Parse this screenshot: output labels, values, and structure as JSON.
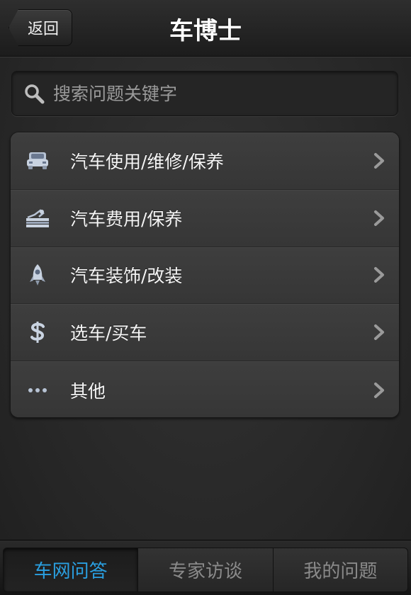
{
  "header": {
    "back_label": "返回",
    "title": "车博士"
  },
  "search": {
    "placeholder": "搜索问题关键字",
    "icon": "search-icon"
  },
  "menu": {
    "items": [
      {
        "label": "汽车使用/维修/保养",
        "icon": "car-icon"
      },
      {
        "label": "汽车费用/保养",
        "icon": "money-stack-icon"
      },
      {
        "label": "汽车装饰/改装",
        "icon": "rocket-icon"
      },
      {
        "label": "选车/买车",
        "icon": "dollar-icon"
      },
      {
        "label": "其他",
        "icon": "more-dots-icon"
      }
    ]
  },
  "tabs": [
    {
      "label": "车网问答",
      "active": true
    },
    {
      "label": "专家访谈",
      "active": false
    },
    {
      "label": "我的问题",
      "active": false
    }
  ],
  "colors": {
    "accent": "#2a9fe0",
    "text": "#f5f5f5",
    "muted": "#8a8a8a"
  }
}
